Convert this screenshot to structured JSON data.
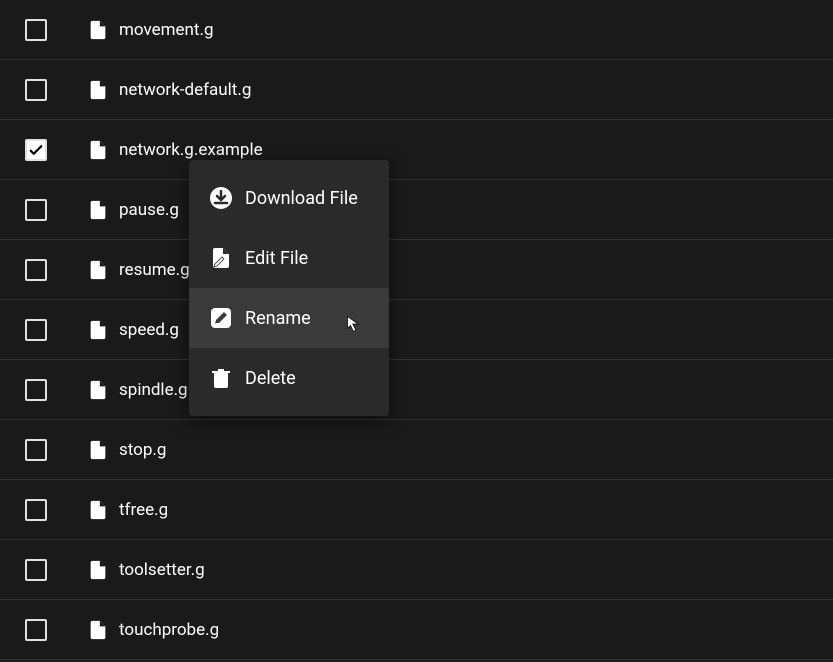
{
  "files": [
    {
      "name": "movement.g",
      "checked": false
    },
    {
      "name": "network-default.g",
      "checked": false
    },
    {
      "name": "network.g.example",
      "checked": true
    },
    {
      "name": "pause.g",
      "checked": false
    },
    {
      "name": "resume.g",
      "checked": false
    },
    {
      "name": "speed.g",
      "checked": false
    },
    {
      "name": "spindle.g",
      "checked": false
    },
    {
      "name": "stop.g",
      "checked": false
    },
    {
      "name": "tfree.g",
      "checked": false
    },
    {
      "name": "toolsetter.g",
      "checked": false
    },
    {
      "name": "touchprobe.g",
      "checked": false
    }
  ],
  "contextMenu": {
    "items": [
      {
        "label": "Download File",
        "icon": "download",
        "highlighted": false
      },
      {
        "label": "Edit File",
        "icon": "edit",
        "highlighted": false
      },
      {
        "label": "Rename",
        "icon": "rename",
        "highlighted": true
      },
      {
        "label": "Delete",
        "icon": "delete",
        "highlighted": false
      }
    ]
  }
}
